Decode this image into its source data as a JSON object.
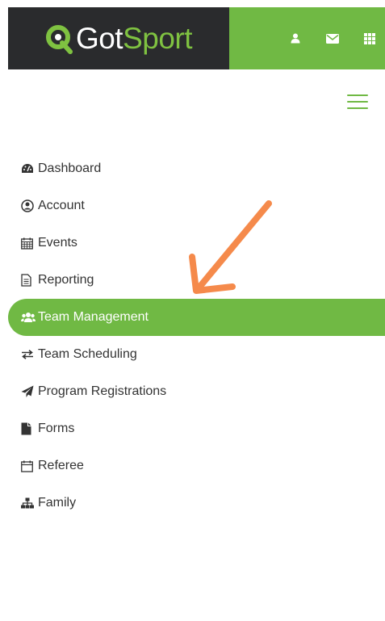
{
  "brand": {
    "logo_text_got": "Got",
    "logo_text_sport": "Sport"
  },
  "header_icons": [
    "user-icon",
    "envelope-icon",
    "grid-icon"
  ],
  "menu": {
    "items": [
      {
        "label": "Dashboard",
        "icon": "dashboard-icon"
      },
      {
        "label": "Account",
        "icon": "user-circle-icon"
      },
      {
        "label": "Events",
        "icon": "calendar-icon"
      },
      {
        "label": "Reporting",
        "icon": "document-icon"
      },
      {
        "label": "Team Management",
        "icon": "users-icon",
        "active": true
      },
      {
        "label": "Team Scheduling",
        "icon": "exchange-icon"
      },
      {
        "label": "Program Registrations",
        "icon": "paper-plane-icon"
      },
      {
        "label": "Forms",
        "icon": "file-icon"
      },
      {
        "label": "Referee",
        "icon": "calendar-blank-icon"
      },
      {
        "label": "Family",
        "icon": "sitemap-icon"
      }
    ]
  },
  "colors": {
    "brand_green": "#70b944",
    "header_dark": "#2a2b2d",
    "arrow_orange": "#f58a4b",
    "text": "#333333"
  }
}
